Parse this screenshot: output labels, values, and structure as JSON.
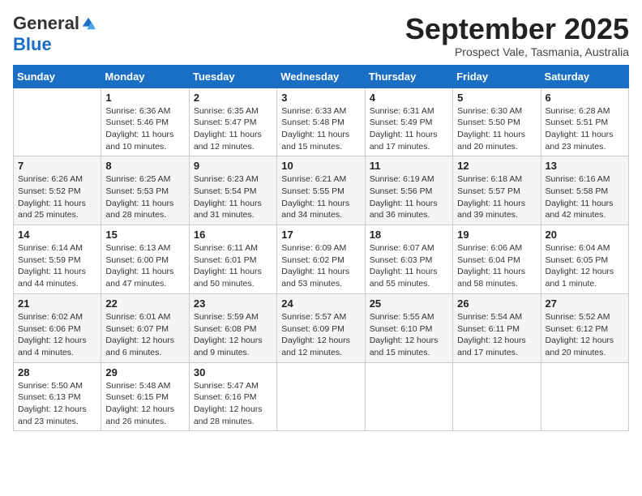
{
  "logo": {
    "general": "General",
    "blue": "Blue"
  },
  "header": {
    "month": "September 2025",
    "location": "Prospect Vale, Tasmania, Australia"
  },
  "days_of_week": [
    "Sunday",
    "Monday",
    "Tuesday",
    "Wednesday",
    "Thursday",
    "Friday",
    "Saturday"
  ],
  "weeks": [
    [
      {
        "day": "",
        "info": ""
      },
      {
        "day": "1",
        "info": "Sunrise: 6:36 AM\nSunset: 5:46 PM\nDaylight: 11 hours\nand 10 minutes."
      },
      {
        "day": "2",
        "info": "Sunrise: 6:35 AM\nSunset: 5:47 PM\nDaylight: 11 hours\nand 12 minutes."
      },
      {
        "day": "3",
        "info": "Sunrise: 6:33 AM\nSunset: 5:48 PM\nDaylight: 11 hours\nand 15 minutes."
      },
      {
        "day": "4",
        "info": "Sunrise: 6:31 AM\nSunset: 5:49 PM\nDaylight: 11 hours\nand 17 minutes."
      },
      {
        "day": "5",
        "info": "Sunrise: 6:30 AM\nSunset: 5:50 PM\nDaylight: 11 hours\nand 20 minutes."
      },
      {
        "day": "6",
        "info": "Sunrise: 6:28 AM\nSunset: 5:51 PM\nDaylight: 11 hours\nand 23 minutes."
      }
    ],
    [
      {
        "day": "7",
        "info": "Sunrise: 6:26 AM\nSunset: 5:52 PM\nDaylight: 11 hours\nand 25 minutes."
      },
      {
        "day": "8",
        "info": "Sunrise: 6:25 AM\nSunset: 5:53 PM\nDaylight: 11 hours\nand 28 minutes."
      },
      {
        "day": "9",
        "info": "Sunrise: 6:23 AM\nSunset: 5:54 PM\nDaylight: 11 hours\nand 31 minutes."
      },
      {
        "day": "10",
        "info": "Sunrise: 6:21 AM\nSunset: 5:55 PM\nDaylight: 11 hours\nand 34 minutes."
      },
      {
        "day": "11",
        "info": "Sunrise: 6:19 AM\nSunset: 5:56 PM\nDaylight: 11 hours\nand 36 minutes."
      },
      {
        "day": "12",
        "info": "Sunrise: 6:18 AM\nSunset: 5:57 PM\nDaylight: 11 hours\nand 39 minutes."
      },
      {
        "day": "13",
        "info": "Sunrise: 6:16 AM\nSunset: 5:58 PM\nDaylight: 11 hours\nand 42 minutes."
      }
    ],
    [
      {
        "day": "14",
        "info": "Sunrise: 6:14 AM\nSunset: 5:59 PM\nDaylight: 11 hours\nand 44 minutes."
      },
      {
        "day": "15",
        "info": "Sunrise: 6:13 AM\nSunset: 6:00 PM\nDaylight: 11 hours\nand 47 minutes."
      },
      {
        "day": "16",
        "info": "Sunrise: 6:11 AM\nSunset: 6:01 PM\nDaylight: 11 hours\nand 50 minutes."
      },
      {
        "day": "17",
        "info": "Sunrise: 6:09 AM\nSunset: 6:02 PM\nDaylight: 11 hours\nand 53 minutes."
      },
      {
        "day": "18",
        "info": "Sunrise: 6:07 AM\nSunset: 6:03 PM\nDaylight: 11 hours\nand 55 minutes."
      },
      {
        "day": "19",
        "info": "Sunrise: 6:06 AM\nSunset: 6:04 PM\nDaylight: 11 hours\nand 58 minutes."
      },
      {
        "day": "20",
        "info": "Sunrise: 6:04 AM\nSunset: 6:05 PM\nDaylight: 12 hours\nand 1 minute."
      }
    ],
    [
      {
        "day": "21",
        "info": "Sunrise: 6:02 AM\nSunset: 6:06 PM\nDaylight: 12 hours\nand 4 minutes."
      },
      {
        "day": "22",
        "info": "Sunrise: 6:01 AM\nSunset: 6:07 PM\nDaylight: 12 hours\nand 6 minutes."
      },
      {
        "day": "23",
        "info": "Sunrise: 5:59 AM\nSunset: 6:08 PM\nDaylight: 12 hours\nand 9 minutes."
      },
      {
        "day": "24",
        "info": "Sunrise: 5:57 AM\nSunset: 6:09 PM\nDaylight: 12 hours\nand 12 minutes."
      },
      {
        "day": "25",
        "info": "Sunrise: 5:55 AM\nSunset: 6:10 PM\nDaylight: 12 hours\nand 15 minutes."
      },
      {
        "day": "26",
        "info": "Sunrise: 5:54 AM\nSunset: 6:11 PM\nDaylight: 12 hours\nand 17 minutes."
      },
      {
        "day": "27",
        "info": "Sunrise: 5:52 AM\nSunset: 6:12 PM\nDaylight: 12 hours\nand 20 minutes."
      }
    ],
    [
      {
        "day": "28",
        "info": "Sunrise: 5:50 AM\nSunset: 6:13 PM\nDaylight: 12 hours\nand 23 minutes."
      },
      {
        "day": "29",
        "info": "Sunrise: 5:48 AM\nSunset: 6:15 PM\nDaylight: 12 hours\nand 26 minutes."
      },
      {
        "day": "30",
        "info": "Sunrise: 5:47 AM\nSunset: 6:16 PM\nDaylight: 12 hours\nand 28 minutes."
      },
      {
        "day": "",
        "info": ""
      },
      {
        "day": "",
        "info": ""
      },
      {
        "day": "",
        "info": ""
      },
      {
        "day": "",
        "info": ""
      }
    ]
  ]
}
